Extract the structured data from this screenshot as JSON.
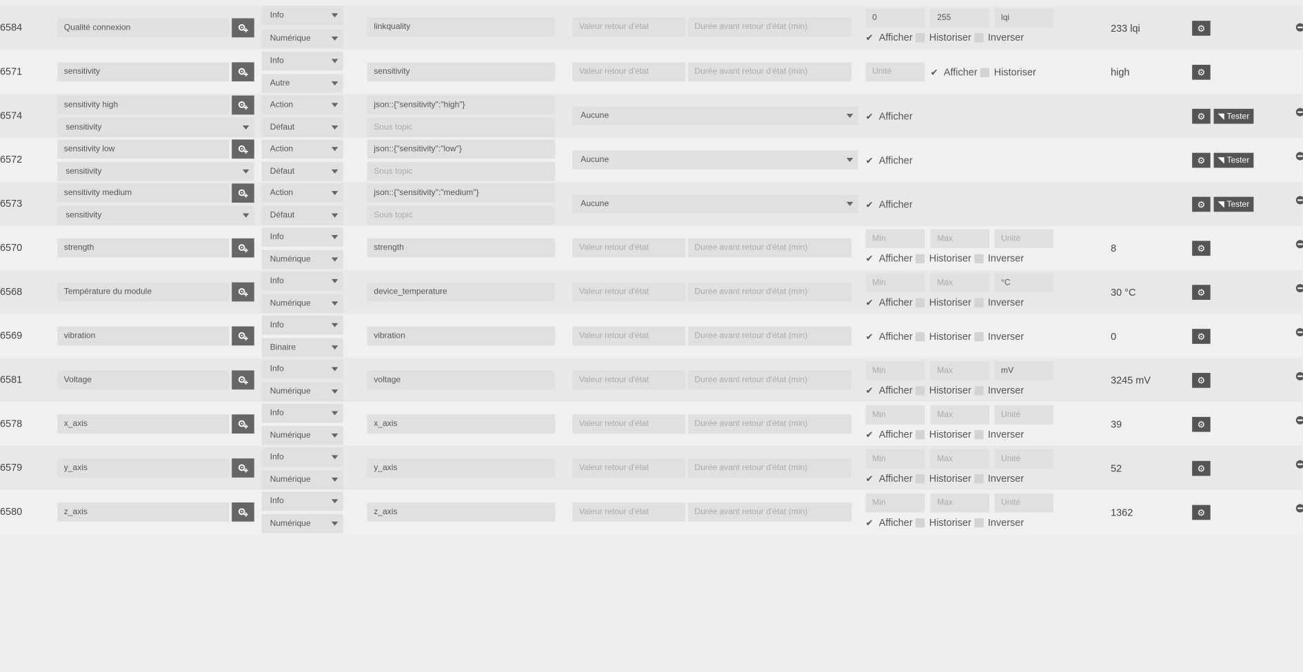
{
  "rows": [
    {
      "id": "6584",
      "name": "Qualité connexion",
      "type": "Info",
      "subtype": "Numérique",
      "logical": "linkquality",
      "return_state": "Valeur retour d'état",
      "return_delay": "Durée avant retour d'état (min)",
      "min": "0",
      "max": "255",
      "unit": "lqi",
      "afficher": "Afficher",
      "historiser": "Historiser",
      "inverser": "Inverser",
      "value": "233 lqi"
    },
    {
      "id": "6571",
      "name": "sensitivity",
      "type": "Info",
      "subtype": "Autre",
      "logical": "sensitivity",
      "return_state": "Valeur retour d'état",
      "return_delay": "Durée avant retour d'état (min)",
      "unit": "Unité",
      "afficher": "Afficher",
      "historiser": "Historiser",
      "value": "high"
    },
    {
      "id": "6574",
      "name": "sensitivity high",
      "parent": "sensitivity",
      "type": "Action",
      "subtype": "Défaut",
      "logical": "json::{\"sensitivity\":\"high\"}",
      "subtopic": "Sous topic",
      "select": "Aucune",
      "afficher": "Afficher",
      "tester": "Tester"
    },
    {
      "id": "6572",
      "name": "sensitivity low",
      "parent": "sensitivity",
      "type": "Action",
      "subtype": "Défaut",
      "logical": "json::{\"sensitivity\":\"low\"}",
      "subtopic": "Sous topic",
      "select": "Aucune",
      "afficher": "Afficher",
      "tester": "Tester"
    },
    {
      "id": "6573",
      "name": "sensitivity medium",
      "parent": "sensitivity",
      "type": "Action",
      "subtype": "Défaut",
      "logical": "json::{\"sensitivity\":\"medium\"}",
      "subtopic": "Sous topic",
      "select": "Aucune",
      "afficher": "Afficher",
      "tester": "Tester"
    },
    {
      "id": "6570",
      "name": "strength",
      "type": "Info",
      "subtype": "Numérique",
      "logical": "strength",
      "return_state": "Valeur retour d'état",
      "return_delay": "Durée avant retour d'état (min)",
      "min": "Min",
      "max": "Max",
      "unit": "Unité",
      "afficher": "Afficher",
      "historiser": "Historiser",
      "inverser": "Inverser",
      "value": "8"
    },
    {
      "id": "6568",
      "name": "Température du module",
      "type": "Info",
      "subtype": "Numérique",
      "logical": "device_temperature",
      "return_state": "Valeur retour d'état",
      "return_delay": "Durée avant retour d'état (min)",
      "min": "Min",
      "max": "Max",
      "unit": "°C",
      "afficher": "Afficher",
      "historiser": "Historiser",
      "inverser": "Inverser",
      "value": "30 °C"
    },
    {
      "id": "6569",
      "name": "vibration",
      "type": "Info",
      "subtype": "Binaire",
      "logical": "vibration",
      "return_state": "Valeur retour d'état",
      "return_delay": "Durée avant retour d'état (min)",
      "afficher": "Afficher",
      "historiser": "Historiser",
      "inverser": "Inverser",
      "value": "0"
    },
    {
      "id": "6581",
      "name": "Voltage",
      "type": "Info",
      "subtype": "Numérique",
      "logical": "voltage",
      "return_state": "Valeur retour d'état",
      "return_delay": "Durée avant retour d'état (min)",
      "min": "Min",
      "max": "Max",
      "unit": "mV",
      "afficher": "Afficher",
      "historiser": "Historiser",
      "inverser": "Inverser",
      "value": "3245 mV"
    },
    {
      "id": "6578",
      "name": "x_axis",
      "type": "Info",
      "subtype": "Numérique",
      "logical": "x_axis",
      "return_state": "Valeur retour d'état",
      "return_delay": "Durée avant retour d'état (min)",
      "min": "Min",
      "max": "Max",
      "unit": "Unité",
      "afficher": "Afficher",
      "historiser": "Historiser",
      "inverser": "Inverser",
      "value": "39"
    },
    {
      "id": "6579",
      "name": "y_axis",
      "type": "Info",
      "subtype": "Numérique",
      "logical": "y_axis",
      "return_state": "Valeur retour d'état",
      "return_delay": "Durée avant retour d'état (min)",
      "min": "Min",
      "max": "Max",
      "unit": "Unité",
      "afficher": "Afficher",
      "historiser": "Historiser",
      "inverser": "Inverser",
      "value": "52"
    },
    {
      "id": "6580",
      "name": "z_axis",
      "type": "Info",
      "subtype": "Numérique",
      "logical": "z_axis",
      "return_state": "Valeur retour d'état",
      "return_delay": "Durée avant retour d'état (min)",
      "min": "Min",
      "max": "Max",
      "unit": "Unité",
      "afficher": "Afficher",
      "historiser": "Historiser",
      "inverser": "Inverser",
      "value": "1362"
    }
  ],
  "icons": {
    "name_button": "cog-plus-icon",
    "config": "cogs-icon",
    "tester": "rss-icon",
    "remove": "minus-circle-icon"
  }
}
